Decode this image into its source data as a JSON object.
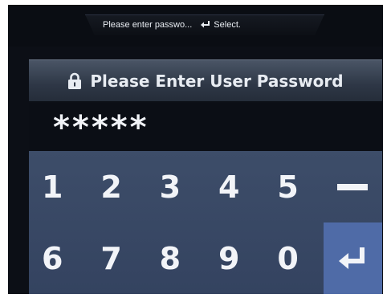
{
  "hint_bar": {
    "hint_text": "Please enter passwo...",
    "select_label": "Select.",
    "select_icon": "enter-arrow-icon"
  },
  "header": {
    "icon": "lock-icon",
    "title": "Please Enter User Password"
  },
  "password": {
    "masked_value": "*****"
  },
  "keypad": {
    "row1": [
      "1",
      "2",
      "3",
      "4",
      "5"
    ],
    "row2": [
      "6",
      "7",
      "8",
      "9",
      "0"
    ],
    "delete_icon": "minus-icon",
    "enter_icon": "enter-arrow-icon",
    "colors": {
      "background": "#3d4d69",
      "enter_key": "#4f6ba7"
    }
  }
}
